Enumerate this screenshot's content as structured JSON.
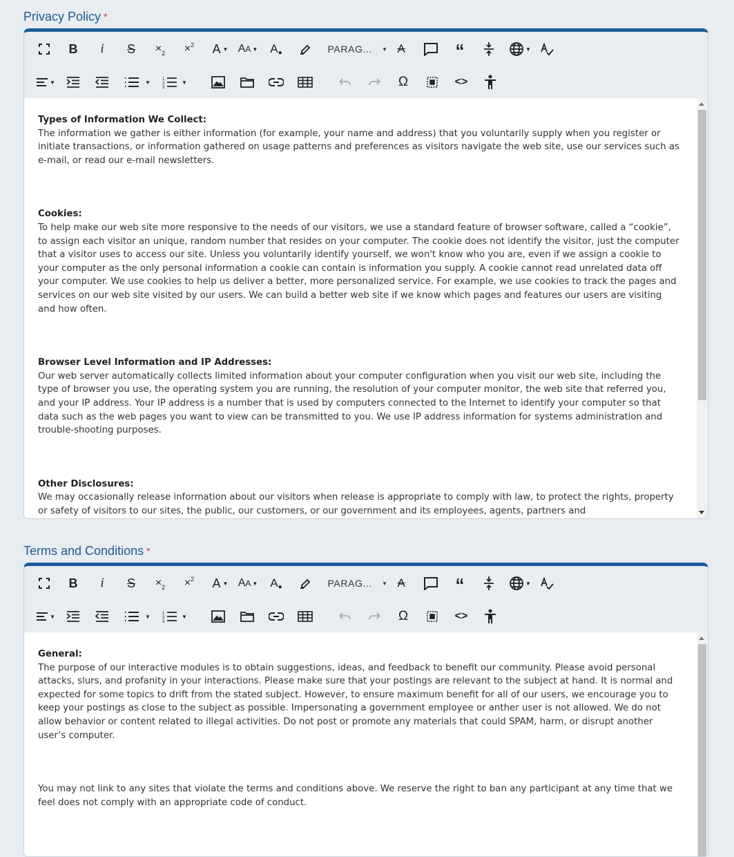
{
  "toolbar": {
    "paragraph_label": "PARAG..."
  },
  "privacy": {
    "label": "Privacy Policy",
    "required_mark": "*",
    "sections": [
      {
        "heading": "Types of Information We Collect:",
        "body": "The information we gather is either information (for example, your name and address) that you voluntarily supply when you register or initiate transactions, or information gathered on usage patterns and preferences as visitors navigate the web site, use our services such as e-mail, or read our e-mail newsletters."
      },
      {
        "heading": "Cookies:",
        "body": "To help make our web site more responsive to the needs of our visitors, we use a standard feature of browser software, called a “cookie”, to assign each visitor an unique, random number that resides on your computer. The cookie does not identify the visitor, just the computer that a visitor uses to access our site. Unless you voluntarily identify yourself, we won't know who you are, even if we assign a cookie to your computer as the only personal information a cookie can contain is information you supply. A cookie cannot read unrelated data off your computer. We use cookies to help us deliver a better, more personalized service. For example, we use cookies to track the pages and services on our web site visited by our users. We can build a better web site if we know which pages and features our users are visiting and how often."
      },
      {
        "heading": "Browser Level Information and IP Addresses:",
        "body": "Our web server automatically collects limited information about your computer configuration when you visit our web site, including the type of browser you use, the operating system you are running, the resolution of your computer monitor, the web site that referred you, and your IP address. Your IP address is a number that is used by computers connected to the Internet to identify your computer so that data such as the web pages you want to view can be transmitted to you. We use IP address information for systems administration and trouble-shooting purposes."
      },
      {
        "heading": "Other Disclosures:",
        "body": "We may occasionally release information about our visitors when release is appropriate to comply with law, to protect the rights, property or safety of visitors to our sites, the public, our customers, or our government and its employees, agents, partners and"
      }
    ]
  },
  "terms": {
    "label": "Terms and Conditions",
    "required_mark": "*",
    "sections": [
      {
        "heading": "General:",
        "body": "The purpose of our interactive modules is to obtain suggestions, ideas, and feedback to benefit our community. Please avoid personal attacks, slurs, and profanity in your interactions. Please make sure that your postings are relevant to the subject at hand. It is normal and expected for some topics to drift from the stated subject. However, to ensure maximum benefit for all of our users, we encourage you to keep your postings as close to the subject as possible. Impersonating a government employee or anther user is not allowed. We do not allow behavior or content related to illegal activities. Do not post or promote any materials that could SPAM, harm, or disrupt another user’s computer."
      },
      {
        "heading": "",
        "body": "You may not link to any sites that violate the terms and conditions above. We reserve the right to ban any participant at any time that we feel does not comply with an appropriate code of conduct."
      }
    ]
  }
}
